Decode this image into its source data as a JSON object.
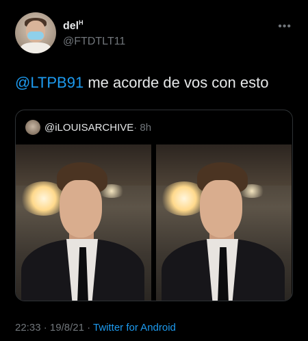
{
  "author": {
    "name": "del",
    "name_suffix": "H",
    "handle": "@FTDTLT11"
  },
  "tweet": {
    "mention": "@LTPB91",
    "text": " me acorde de vos con esto"
  },
  "quoted": {
    "handle": "@iLOUISARCHIVE",
    "time": "· 8h"
  },
  "meta": {
    "time": "22:33",
    "sep1": " · ",
    "date": "19/8/21",
    "sep2": " · ",
    "source": "Twitter for Android"
  },
  "icons": {
    "more": "more-horizontal-icon"
  },
  "colors": {
    "background": "#000000",
    "text": "#e7e9ea",
    "secondary": "#71767b",
    "accent": "#1d9bf0",
    "border": "#2f3336"
  }
}
